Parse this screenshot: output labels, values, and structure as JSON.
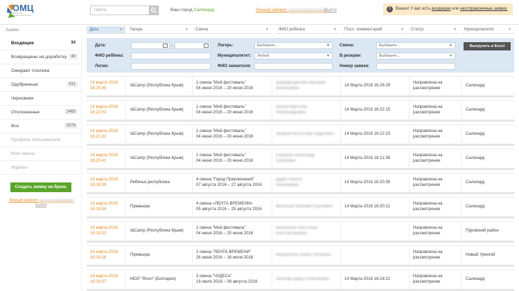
{
  "header": {
    "logo_text": "ОМЦ",
    "logo_sub": "Областной методический центр",
    "search_placeholder": "Найти",
    "city_label": "Ваш город",
    "city_value": "Салехард",
    "cabinet_label": "Личный кабинет",
    "cabinet_user": "username@example",
    "exit_label": "Выйти",
    "alert_prefix": "Важно! У вас есть",
    "alert_link1": "входящие",
    "alert_mid": "или",
    "alert_link2": "неотправленные заявки."
  },
  "columns": {
    "section_label": "Заявки",
    "date": "Дата",
    "camp": "Лагерь",
    "shift": "Смена",
    "child": "ФИО ребёнка",
    "comment": "Посл. комментарий",
    "status": "Статус",
    "mun": "Муниципалитет"
  },
  "sidebar": {
    "items": [
      {
        "label": "Входящие",
        "count": "34"
      },
      {
        "label": "Возвращены на доработку",
        "count": "48"
      },
      {
        "label": "Ожидают платежа",
        "count": ""
      },
      {
        "label": "Одобренные",
        "count": "431"
      },
      {
        "label": "Черновики",
        "count": ""
      },
      {
        "label": "Отклоненные",
        "count": "2465"
      },
      {
        "label": "Все",
        "count": "2978"
      },
      {
        "label": "Профиль пользователя",
        "count": ""
      },
      {
        "label": "Мои смены",
        "count": ""
      },
      {
        "label": "Журнал",
        "count": ""
      }
    ],
    "new_button": "Создать заявку на бронь",
    "cabinet_label": "Личный кабинет",
    "cabinet_user": "username@example",
    "exit_label": "Выйти"
  },
  "filters": {
    "date_label": "Дата:",
    "date_sep": "-",
    "camp_label": "Лагерь:",
    "camp_value": "Выберите...",
    "shift_label": "Смена:",
    "shift_value": "Выберите...",
    "child_label": "ФИО ребёнка:",
    "mun_label": "Муниципалитет:",
    "mun_value": "Любой",
    "reserve_label": "В резерве:",
    "reserve_value": "Выберите...",
    "login_label": "Логин:",
    "applicant_label": "ФИО заявителя:",
    "number_label": "Номер заявки:",
    "excel_button": "Выгрузить в Excel"
  },
  "rows": [
    {
      "date": "14 марта 2016",
      "time": "16:25:45",
      "camp": "I&Camp (Республика Крым)",
      "shift1": "1 смена \"Мой фестиваль\"",
      "shift2": "04 июня 2016 – 20 июня 2016",
      "child1": "Шарафутдинова Валерия",
      "child2": "Васильевна",
      "comment": "14 Марта 2016 16:26:29",
      "status1": "Направлена на",
      "status2": "рассмотрение",
      "mun": "Салехард"
    },
    {
      "date": "14 марта 2016",
      "time": "16:22:02",
      "camp": "I&Camp (Республика Крым)",
      "shift1": "1 смена \"Мой фестиваль\"",
      "shift2": "04 июня 2016 – 20 июня 2016",
      "child1": "Шулик Кристина",
      "child2": "Александровна",
      "comment": "14 Марта 2016 16:22:15",
      "status1": "Направлена на",
      "status2": "рассмотрение",
      "mun": "Салехард"
    },
    {
      "date": "14 марта 2016",
      "time": "16:21:32",
      "camp": "I&Camp (Республика Крым)",
      "shift1": "1 смена \"Мой фестиваль\"",
      "shift2": "04 июня 2016 – 20 июня 2016",
      "child1": "Захаров Мстислав Андреевич",
      "child2": "",
      "comment": "14 Марта 2016 16:22:23",
      "status1": "Направлена на",
      "status2": "рассмотрение",
      "mun": "Салехард"
    },
    {
      "date": "14 марта 2016",
      "time": "16:20:41",
      "camp": "I&Camp (Республика Крым)",
      "shift1": "1 смена \"Мой фестиваль\"",
      "shift2": "04 июня 2016 – 20 июня 2016",
      "child1": "Сидоров Александр",
      "child2": "Сергеевич",
      "comment": "14 Марта 2016 16:21:38",
      "status1": "Направлена на",
      "status2": "рассмотрение",
      "mun": "Салехард"
    },
    {
      "date": "14 марта 2016",
      "time": "16:19:55",
      "camp": "Ребячья республика",
      "shift1": "4 смена \"Город Приключений\"",
      "shift2": "07 августа 2016 – 27 августа 2016",
      "child1": "Дудко Никита",
      "child2": "Николаевич",
      "comment": "14 Марта 2016 16:20:38",
      "status1": "Направлена на",
      "status2": "рассмотрение",
      "mun": "Салехард"
    },
    {
      "date": "14 марта 2016",
      "time": "16:19:54",
      "camp": "Премьера",
      "shift1": "4 смена «ЛЕНТА ВРЕМЕНИ»",
      "shift2": "05 августа 2016 – 25 августа 2016",
      "child1": "Васильев Евгений Сергеевич",
      "child2": "",
      "comment": "14 Марта 2016 16:20:12",
      "status1": "Направлена на",
      "status2": "рассмотрение",
      "mun": "Салехард"
    },
    {
      "date": "14 марта 2016",
      "time": "16:19:02",
      "camp": "I&Camp (Республика Крым)",
      "shift1": "1 смена \"Мой фестиваль\"",
      "shift2": "04 июня 2016 – 20 июня 2016",
      "child1": "Ветрицкая Анастасия",
      "child2": "Константиновна",
      "comment": "",
      "status1": "Направлена на",
      "status2": "рассмотрение",
      "mun": "Пуровский район"
    },
    {
      "date": "14 марта 2016",
      "time": "16:18:16",
      "camp": "Премьера",
      "shift1": "2 смена \"ЛЕНТА ВРЕМЕНИ\"",
      "shift2": "26 июня 2016 – 16 июля 2016",
      "child1": "Ишмухтина Лиана Петровна",
      "child2": "",
      "comment": "",
      "status1": "Направлена на",
      "status2": "рассмотрение",
      "mun": "Новый Уренгой"
    },
    {
      "date": "14 марта 2016",
      "time": "16:18:07",
      "camp": "МОЛ \"Ялол\" (Болгария)",
      "shift1": "3 смена \"ЧУДЕСА\"",
      "shift2": "18 июля 2016 – 08 августа 2016",
      "child1": "Анисова Дарья Алексеевна",
      "child2": "",
      "comment": "14 Марта 2016 16:18:22",
      "status1": "Направлена на",
      "status2": "рассмотрение",
      "mun": "Салехард"
    }
  ]
}
